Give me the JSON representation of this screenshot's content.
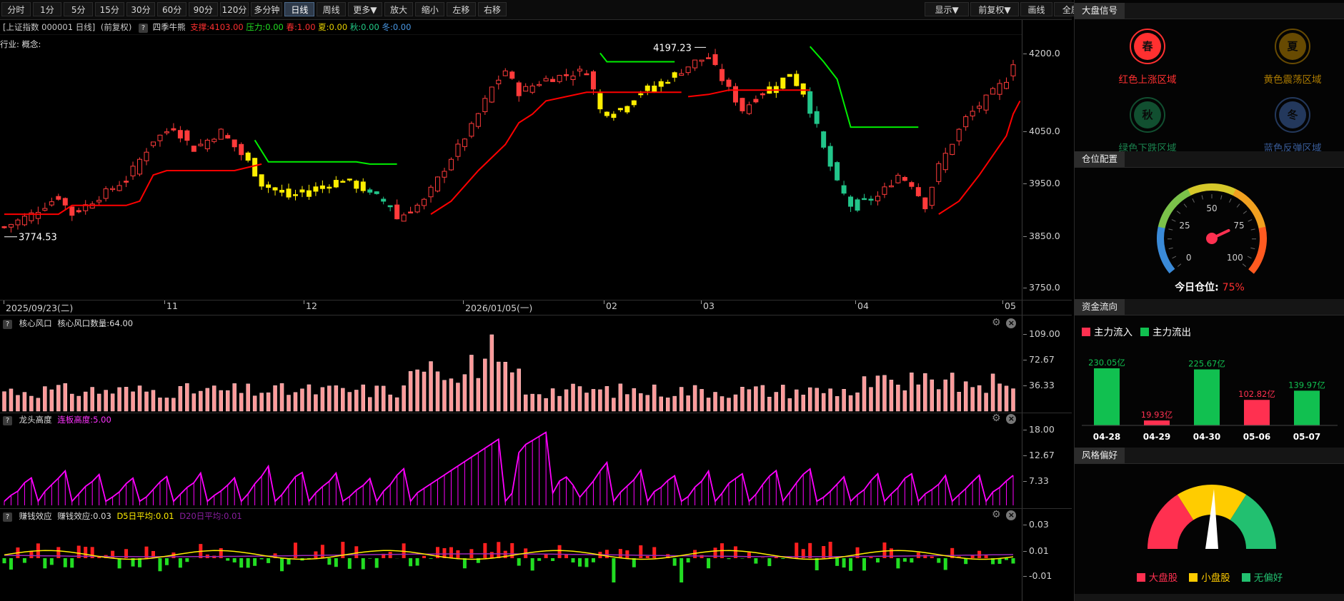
{
  "toolbar": {
    "left_buttons": [
      "分时",
      "1分",
      "5分",
      "15分",
      "30分",
      "60分",
      "90分",
      "120分",
      "多分钟",
      "日线",
      "周线",
      "更多▼",
      "放大",
      "缩小",
      "左移",
      "右移"
    ],
    "active": "日线",
    "right_buttons": [
      "显示▼",
      "前复权▼",
      "画线",
      "全屏"
    ]
  },
  "info": {
    "security": "[上证指数 000001 日线]",
    "adjust": "(前复权)",
    "indicator_name": "四季牛熊",
    "support": "支撑:4103.00",
    "pressure": "压力:0.00",
    "spring": "春:1.00",
    "summer": "夏:0.00",
    "autumn": "秋:0.00",
    "winter": "冬:0.00",
    "industry_line": "行业:  概念:"
  },
  "main_chart": {
    "y_ticks": [
      "4200.0",
      "4050.0",
      "3950.0",
      "3850.0",
      "3750.0"
    ],
    "high_label": "4197.23",
    "low_label": "3774.53",
    "date_labels": [
      "2025/09/23(二)",
      "11",
      "12",
      "2026/01/05(一)",
      "02",
      "03",
      "04",
      "05"
    ]
  },
  "panel1": {
    "title": "核心风口",
    "value_label": "核心风口数量:64.00",
    "y_ticks": [
      "109.00",
      "72.67",
      "36.33"
    ]
  },
  "panel2": {
    "title": "龙头高度",
    "value_label": "连板高度:5.00",
    "y_ticks": [
      "18.00",
      "12.67",
      "7.33"
    ]
  },
  "panel3": {
    "title": "赚钱效应",
    "value_label": "赚钱效应:0.03",
    "d5_label": "D5日平均:0.01",
    "d20_label": "D20日平均:0.01",
    "y_ticks": [
      "0.03",
      "0.01",
      "-0.01"
    ]
  },
  "right_panel": {
    "market_signal": {
      "title": "大盘信号",
      "items": [
        {
          "glyph": "春",
          "label": "红色上涨区域",
          "color": "#ff3030"
        },
        {
          "glyph": "夏",
          "label": "黄色震荡区域",
          "color": "#e0a000"
        },
        {
          "glyph": "秋",
          "label": "绿色下跌区域",
          "color": "#22aa66"
        },
        {
          "glyph": "冬",
          "label": "蓝色反弹区域",
          "color": "#4a78c8"
        }
      ]
    },
    "position": {
      "title": "仓位配置",
      "gauge_ticks": [
        "0",
        "25",
        "50",
        "75",
        "100"
      ],
      "today_label": "今日仓位:",
      "today_value": "75%",
      "value_fraction": 0.75
    },
    "fund_flow": {
      "title": "资金流向",
      "legend_in": "主力流入",
      "legend_out": "主力流出",
      "bars": [
        {
          "date": "04-28",
          "value": 230.05,
          "label": "230.05亿",
          "dir": "out"
        },
        {
          "date": "04-29",
          "value": 19.93,
          "label": "19.93亿",
          "dir": "in"
        },
        {
          "date": "04-30",
          "value": 225.67,
          "label": "225.67亿",
          "dir": "out"
        },
        {
          "date": "05-06",
          "value": 102.82,
          "label": "102.82亿",
          "dir": "in"
        },
        {
          "date": "05-07",
          "value": 139.97,
          "label": "139.97亿",
          "dir": "out"
        }
      ]
    },
    "style": {
      "title": "风格偏好",
      "legend": [
        "大盘股",
        "小盘股",
        "无偏好"
      ],
      "colors": [
        "#ff3050",
        "#ffcc00",
        "#22c070"
      ]
    }
  },
  "colors": {
    "up": "#ff3b3b",
    "down": "#22c58a",
    "yellow_candle": "#ffee00",
    "support_line": "#ff0000",
    "pressure_line": "#00ee00",
    "purple": "#ff00ff",
    "pink_bar": "#ff9a9a"
  }
}
